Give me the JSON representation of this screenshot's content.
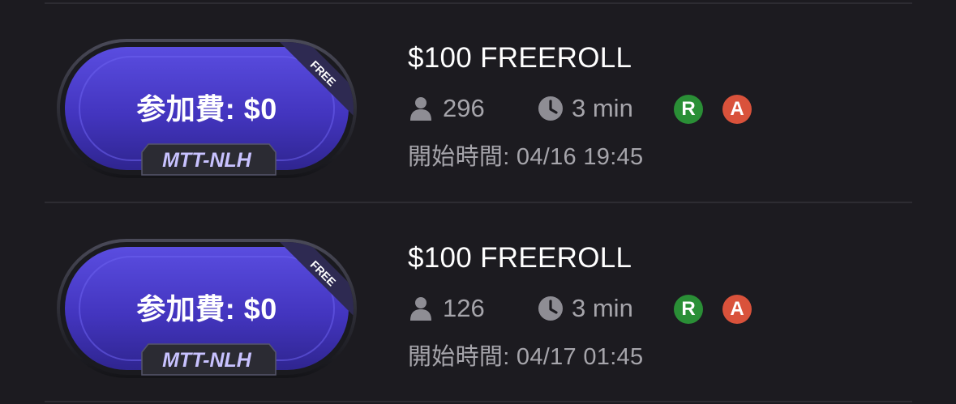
{
  "tournaments": [
    {
      "fee_label": "参加費: $0",
      "game_type": "MTT-NLH",
      "ribbon": "FREE",
      "title": "$100 FREEROLL",
      "players": "296",
      "level_time": "3 min",
      "chip_r": "R",
      "chip_a": "A",
      "start_time": "開始時間: 04/16 19:45"
    },
    {
      "fee_label": "参加費: $0",
      "game_type": "MTT-NLH",
      "ribbon": "FREE",
      "title": "$100 FREEROLL",
      "players": "126",
      "level_time": "3 min",
      "chip_r": "R",
      "chip_a": "A",
      "start_time": "開始時間: 04/17 01:45"
    }
  ],
  "icons": {
    "players": "person-icon",
    "time": "clock-icon"
  },
  "colors": {
    "background": "#1c1b20",
    "table_felt": "#4b3fc8",
    "rebuy_chip": "#2a8f36",
    "addon_chip": "#d9523b",
    "muted_text": "#a6a5ab"
  }
}
